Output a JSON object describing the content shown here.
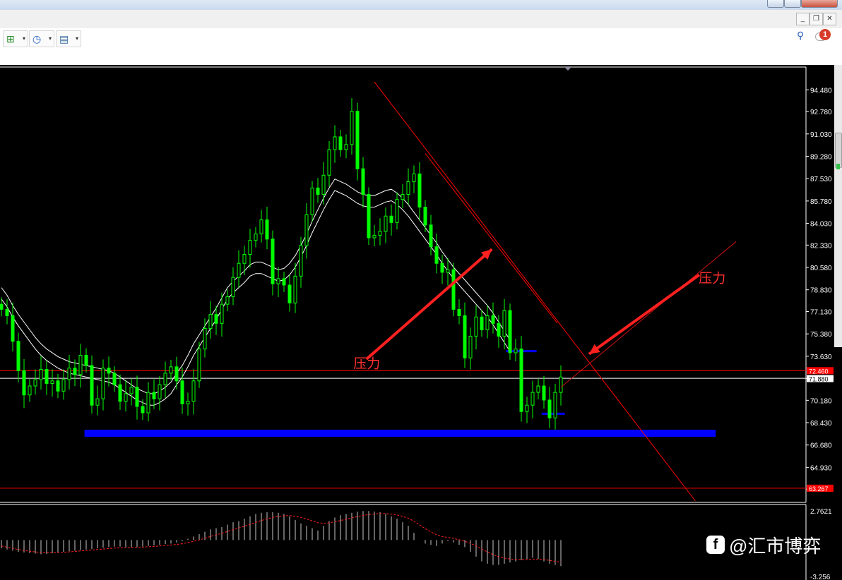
{
  "toolbar": {
    "new_chart_icon": "chart-add-icon",
    "clock_icon": "clock-icon",
    "templates_icon": "template-icon",
    "dropdown_glyph": "▾",
    "search_icon": "search-icon",
    "notification_count": "1"
  },
  "window_controls": {
    "minimize": "_",
    "restore": "❐",
    "close": "✕"
  },
  "colors": {
    "background": "#000000",
    "candle": "#00ff00",
    "ma": "#ffffff",
    "resistance": "#ff0000",
    "support": "#0000ff",
    "arrow": "#ff2020",
    "label": "#ff3030",
    "axis_text": "#ffffff",
    "price_tag": "#ff0000"
  },
  "watermark": {
    "text": "@汇市博弈",
    "logo_letter": "f"
  },
  "chart_data": [
    {
      "type": "candlestick",
      "panel": "price",
      "x_count": 100,
      "ylim": [
        62.3,
        96.1
      ],
      "y_ticks": [
        "94.480",
        "92.780",
        "91.030",
        "89.280",
        "87.530",
        "85.780",
        "84.030",
        "82.330",
        "80.580",
        "78.830",
        "77.130",
        "75.380",
        "73.630",
        "71.880",
        "70.180",
        "68.430",
        "66.680",
        "64.930",
        "63.230"
      ],
      "price_tag_upper": "72.460",
      "price_tag_current": "71.880",
      "price_tag_lower": "63.267",
      "series_close": [
        77.3,
        76.8,
        74.8,
        72.5,
        70.6,
        71.3,
        71.8,
        72.6,
        71.5,
        71.7,
        70.9,
        71.8,
        72.7,
        72.2,
        73.7,
        72.9,
        69.8,
        70.3,
        72.7,
        72.3,
        71.4,
        70.1,
        70.7,
        71.2,
        69.7,
        69.2,
        70.8,
        70.3,
        71.4,
        72.3,
        72.8,
        71.7,
        69.9,
        70.1,
        71.7,
        74.2,
        75.8,
        76.9,
        76.2,
        77.7,
        78.3,
        79.8,
        80.9,
        81.6,
        82.7,
        83.2,
        84.3,
        82.8,
        79.3,
        79.7,
        79.2,
        77.8,
        79.9,
        82.3,
        84.7,
        86.8,
        86.3,
        87.8,
        89.8,
        90.8,
        89.8,
        90.2,
        92.8,
        88.3,
        86.3,
        82.9,
        83.1,
        83.4,
        84.6,
        84.1,
        85.9,
        86.3,
        87.3,
        87.9,
        85.3,
        83.9,
        82.2,
        80.9,
        80.2,
        80.4,
        77.3,
        76.8,
        73.5,
        75.2,
        76.7,
        75.7,
        76.8,
        76.2,
        75.2,
        77.2,
        73.9,
        74.2,
        69.3,
        69.8,
        70.8,
        71.3,
        70.2,
        68.8,
        70.8,
        72.0
      ],
      "moving_averages": [
        {
          "values": [
            79.0,
            78.4,
            77.6,
            76.9,
            76.3,
            75.7,
            75.1,
            74.6,
            74.2,
            73.9,
            73.6,
            73.4,
            73.2,
            73.1,
            73.0,
            72.9,
            72.8,
            72.7,
            72.6,
            72.5,
            72.3,
            72.0,
            71.7,
            71.4,
            71.1,
            70.9,
            70.7,
            70.7,
            70.9,
            71.2,
            71.6,
            72.3,
            72.9,
            73.7,
            74.6,
            75.3,
            76.0,
            76.7,
            77.4,
            78.2,
            79.0,
            79.5,
            79.9,
            80.3,
            80.8,
            81.0,
            81.0,
            80.8,
            80.6,
            80.4,
            80.5,
            80.9,
            81.5,
            82.3,
            83.2,
            84.2,
            85.1,
            86.0,
            86.8,
            87.5,
            87.3,
            87.1,
            86.8,
            86.5,
            86.3,
            86.2,
            86.2,
            86.4,
            86.6,
            86.7,
            86.4,
            86.0,
            85.5,
            84.9,
            84.3,
            83.7,
            83.1,
            82.5,
            81.8,
            81.2,
            80.6,
            80.1,
            79.6,
            79.1,
            78.6,
            78.1,
            77.6,
            77.0,
            76.3,
            75.6,
            74.9
          ]
        },
        {
          "values": [
            78.1,
            77.5,
            76.7,
            76.0,
            75.4,
            74.8,
            74.2,
            73.7,
            73.3,
            73.0,
            72.7,
            72.5,
            72.3,
            72.2,
            72.1,
            72.0,
            71.9,
            71.8,
            71.7,
            71.6,
            71.4,
            71.1,
            70.8,
            70.5,
            70.2,
            70.0,
            69.8,
            69.8,
            70.0,
            70.3,
            70.7,
            71.4,
            72.0,
            72.8,
            73.7,
            74.4,
            75.1,
            75.8,
            76.5,
            77.3,
            78.1,
            78.6,
            79.0,
            79.4,
            79.9,
            80.1,
            80.1,
            79.9,
            79.7,
            79.5,
            79.6,
            80.0,
            80.6,
            81.4,
            82.3,
            83.3,
            84.2,
            85.1,
            85.9,
            86.6,
            86.4,
            86.2,
            85.9,
            85.6,
            85.4,
            85.3,
            85.3,
            85.5,
            85.7,
            85.8,
            85.5,
            85.1,
            84.6,
            84.0,
            83.4,
            82.8,
            82.2,
            81.6,
            80.9,
            80.3,
            79.7,
            79.2,
            78.7,
            78.2,
            77.7,
            77.2,
            76.7,
            76.1,
            75.4,
            74.7,
            74.0
          ]
        }
      ],
      "horizontal_lines": [
        {
          "y": 72.5,
          "color": "red"
        },
        {
          "y": 71.9,
          "color": "white"
        },
        {
          "y": 63.3,
          "color": "red"
        }
      ],
      "support_zone": {
        "y": 67.6,
        "x_start": 14.7,
        "x_end": 126.4,
        "color": "blue"
      },
      "short_supports": [
        {
          "y": 74.0,
          "x_start": 89.3,
          "x_end": 94.7
        },
        {
          "y": 69.1,
          "x_start": 95.6,
          "x_end": 99.7
        }
      ],
      "trendlines": [
        {
          "from": [
            66.0,
            95.1
          ],
          "to": [
            122.8,
            62.3
          ]
        },
        {
          "from": [
            75.0,
            89.5
          ],
          "to": [
            98.4,
            76.2
          ]
        }
      ],
      "arrows": [
        {
          "from": [
            64.6,
            73.4
          ],
          "to": [
            86.8,
            82.0
          ]
        },
        {
          "from": [
            123.5,
            80.0
          ],
          "to": [
            104.0,
            73.8
          ]
        }
      ],
      "annotations": [
        {
          "text": "压力",
          "x": 62.3,
          "y": 72.7
        },
        {
          "text": "压力",
          "x": 123.4,
          "y": 79.4
        }
      ]
    },
    {
      "type": "histogram",
      "panel": "oscillator",
      "ylim": [
        -3.256,
        2.7621
      ],
      "y_ticks": [
        "2.7621",
        "-3.256"
      ],
      "values": [
        -0.7,
        -0.8,
        -0.9,
        -1.0,
        -1.05,
        -1.1,
        -1.15,
        -1.2,
        -1.18,
        -1.12,
        -1.05,
        -1.0,
        -0.95,
        -0.9,
        -0.85,
        -0.8,
        -0.75,
        -0.7,
        -0.65,
        -0.6,
        -0.55,
        -0.55,
        -0.6,
        -0.6,
        -0.6,
        -0.55,
        -0.5,
        -0.45,
        -0.4,
        -0.35,
        -0.3,
        -0.2,
        -0.1,
        0.1,
        0.3,
        0.5,
        0.7,
        0.9,
        1.0,
        1.1,
        1.3,
        1.5,
        1.6,
        1.8,
        2.0,
        2.2,
        2.3,
        2.35,
        2.35,
        2.3,
        2.2,
        2.0,
        1.7,
        1.4,
        1.2,
        1.0,
        0.8,
        1.2,
        1.6,
        1.9,
        2.1,
        2.2,
        2.3,
        2.4,
        2.45,
        2.45,
        2.4,
        2.35,
        2.2,
        2.0,
        1.8,
        1.5,
        1.2,
        0.6,
        0.0,
        -0.3,
        -0.4,
        -0.5,
        -0.3,
        -0.1,
        -0.2,
        -0.4,
        -0.6,
        -1.0,
        -1.4,
        -1.8,
        -2.0,
        -2.1,
        -2.1,
        -2.0,
        -1.9,
        -1.8,
        -1.7,
        -1.6,
        -1.5,
        -1.6,
        -1.8,
        -2.0,
        -2.1,
        -2.2
      ],
      "signal_values": [
        -0.5,
        -0.6,
        -0.7,
        -0.8,
        -0.88,
        -0.95,
        -1.0,
        -1.05,
        -1.08,
        -1.08,
        -1.06,
        -1.03,
        -1.0,
        -0.96,
        -0.92,
        -0.88,
        -0.84,
        -0.8,
        -0.76,
        -0.72,
        -0.68,
        -0.65,
        -0.64,
        -0.63,
        -0.62,
        -0.6,
        -0.57,
        -0.54,
        -0.5,
        -0.46,
        -0.42,
        -0.37,
        -0.31,
        -0.22,
        -0.11,
        0.01,
        0.15,
        0.3,
        0.44,
        0.57,
        0.72,
        0.87,
        1.01,
        1.16,
        1.32,
        1.49,
        1.65,
        1.79,
        1.91,
        2.0,
        2.05,
        2.06,
        2.01,
        1.91,
        1.78,
        1.62,
        1.46,
        1.41,
        1.45,
        1.54,
        1.65,
        1.76,
        1.87,
        1.98,
        2.07,
        2.15,
        2.2,
        2.23,
        2.23,
        2.19,
        2.12,
        2.0,
        1.84,
        1.59,
        1.27,
        0.96,
        0.69,
        0.45,
        0.3,
        0.22,
        0.14,
        0.03,
        -0.1,
        -0.28,
        -0.5,
        -0.76,
        -1.01,
        -1.23,
        -1.4,
        -1.52,
        -1.6,
        -1.64,
        -1.65,
        -1.64,
        -1.61,
        -1.61,
        -1.65,
        -1.72,
        -1.8,
        -1.88
      ]
    }
  ]
}
